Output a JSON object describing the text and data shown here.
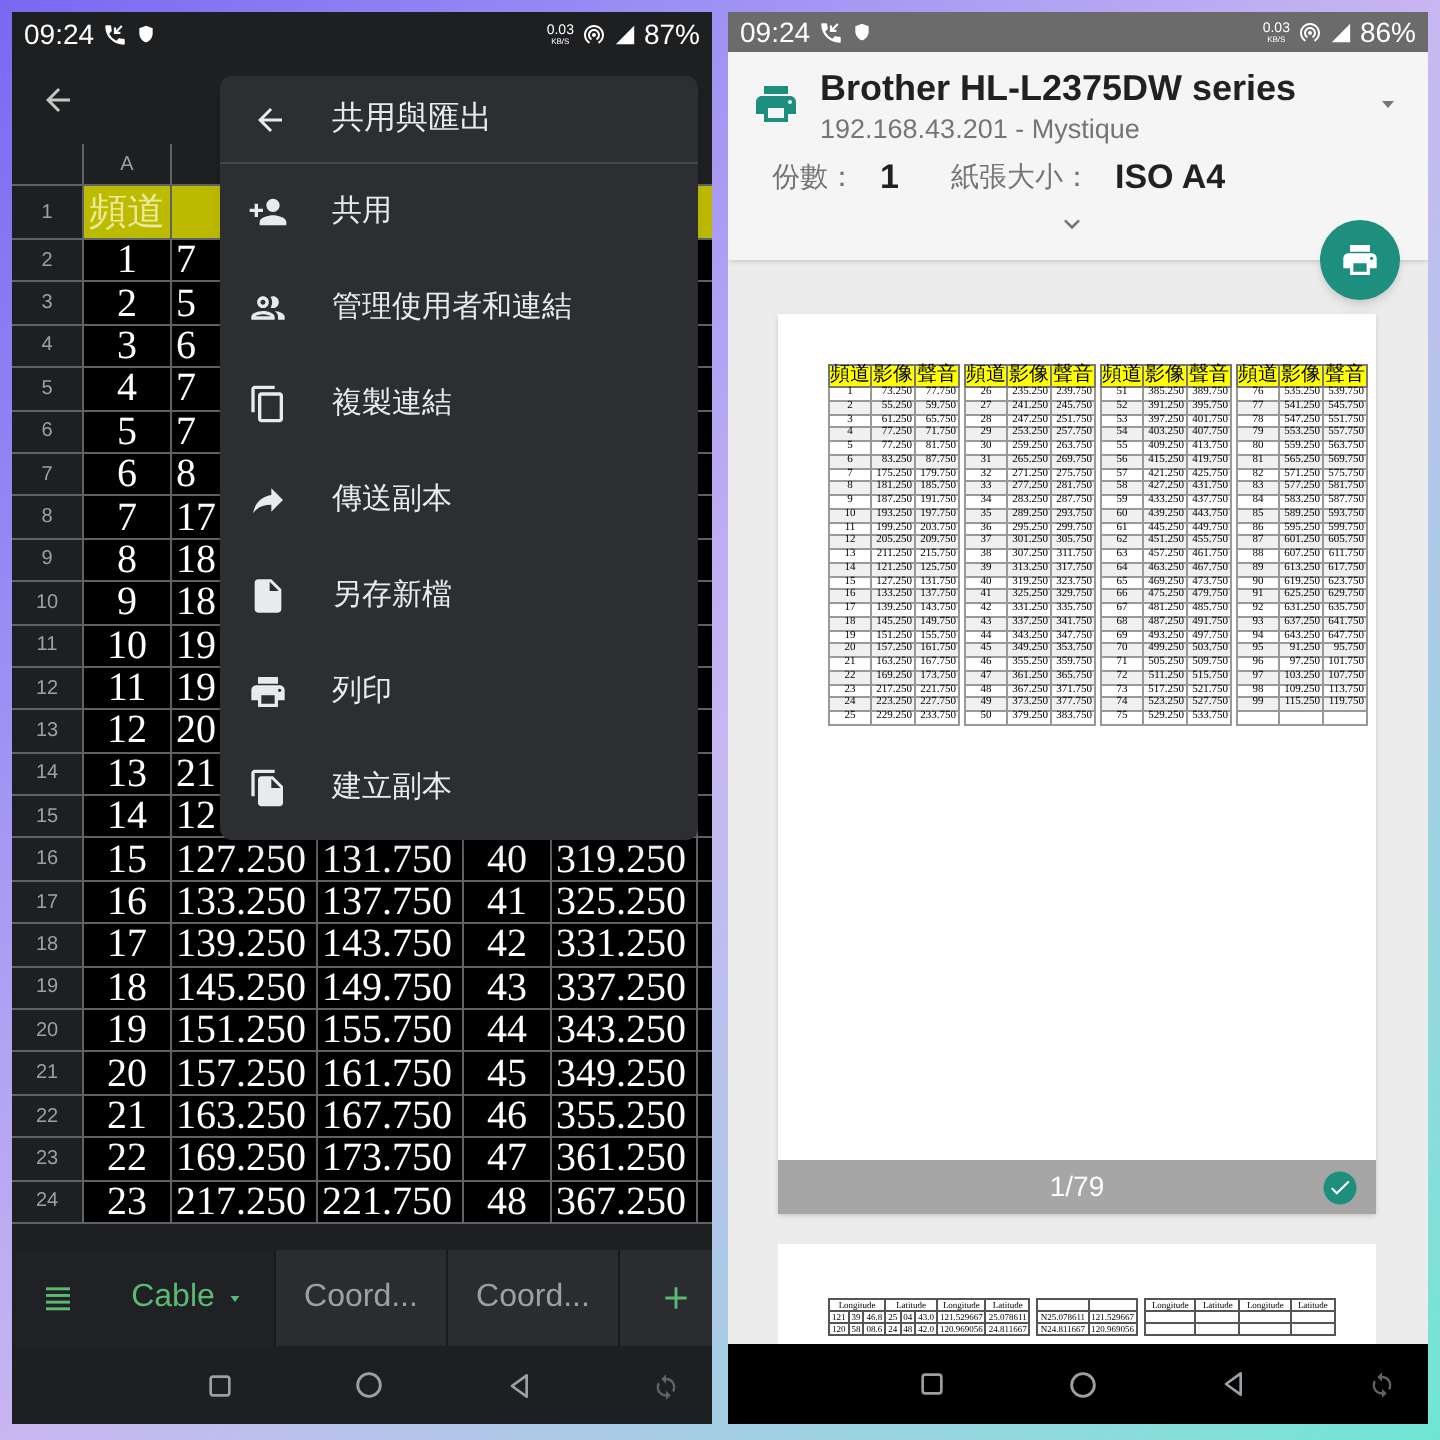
{
  "left": {
    "status_bar": {
      "time": "09:24",
      "speed": "0.03",
      "speed_unit": "KB/S",
      "battery": "87%"
    },
    "sheet": {
      "column_headers": [
        "A"
      ],
      "rows": [
        {
          "number": "1",
          "kind": "header",
          "cells": [
            "頻道"
          ]
        },
        {
          "number": "2",
          "kind": "data",
          "cells": [
            "1",
            "7"
          ]
        },
        {
          "number": "3",
          "kind": "data",
          "cells": [
            "2",
            "5"
          ]
        },
        {
          "number": "4",
          "kind": "data",
          "cells": [
            "3",
            "6"
          ]
        },
        {
          "number": "5",
          "kind": "data",
          "cells": [
            "4",
            "7"
          ]
        },
        {
          "number": "6",
          "kind": "data",
          "cells": [
            "5",
            "7"
          ]
        },
        {
          "number": "7",
          "kind": "data",
          "cells": [
            "6",
            "8"
          ]
        },
        {
          "number": "8",
          "kind": "data",
          "cells": [
            "7",
            "17"
          ]
        },
        {
          "number": "9",
          "kind": "data",
          "cells": [
            "8",
            "18"
          ]
        },
        {
          "number": "10",
          "kind": "data",
          "cells": [
            "9",
            "18"
          ]
        },
        {
          "number": "11",
          "kind": "data",
          "cells": [
            "10",
            "19"
          ]
        },
        {
          "number": "12",
          "kind": "data",
          "cells": [
            "11",
            "19"
          ]
        },
        {
          "number": "13",
          "kind": "data",
          "cells": [
            "12",
            "20"
          ]
        },
        {
          "number": "14",
          "kind": "data",
          "cells": [
            "13",
            "21"
          ]
        },
        {
          "number": "15",
          "kind": "data",
          "cells": [
            "14",
            "12"
          ]
        },
        {
          "number": "16",
          "kind": "data",
          "cells": [
            "15",
            "127.250",
            "131.750",
            "40",
            "319.250"
          ]
        },
        {
          "number": "17",
          "kind": "data",
          "cells": [
            "16",
            "133.250",
            "137.750",
            "41",
            "325.250"
          ]
        },
        {
          "number": "18",
          "kind": "data",
          "cells": [
            "17",
            "139.250",
            "143.750",
            "42",
            "331.250"
          ]
        },
        {
          "number": "19",
          "kind": "data",
          "cells": [
            "18",
            "145.250",
            "149.750",
            "43",
            "337.250"
          ]
        },
        {
          "number": "20",
          "kind": "data",
          "cells": [
            "19",
            "151.250",
            "155.750",
            "44",
            "343.250"
          ]
        },
        {
          "number": "21",
          "kind": "data",
          "cells": [
            "20",
            "157.250",
            "161.750",
            "45",
            "349.250"
          ]
        },
        {
          "number": "22",
          "kind": "data",
          "cells": [
            "21",
            "163.250",
            "167.750",
            "46",
            "355.250"
          ]
        },
        {
          "number": "23",
          "kind": "data",
          "cells": [
            "22",
            "169.250",
            "173.750",
            "47",
            "361.250"
          ]
        },
        {
          "number": "24",
          "kind": "data",
          "cells": [
            "23",
            "217.250",
            "221.750",
            "48",
            "367.250"
          ]
        }
      ]
    },
    "menu": {
      "title": "共用與匯出",
      "items": [
        "共用",
        "管理使用者和連結",
        "複製連結",
        "傳送副本",
        "另存新檔",
        "列印",
        "建立副本"
      ]
    },
    "sheet_tabs": [
      {
        "label": "Cable",
        "selected": true
      },
      {
        "label": "Coord...",
        "selected": false
      },
      {
        "label": "Coord...",
        "selected": false
      }
    ]
  },
  "right": {
    "status_bar": {
      "time": "09:24",
      "speed": "0.03",
      "speed_unit": "KB/S",
      "battery": "86%"
    },
    "printer": {
      "name": "Brother HL-L2375DW series",
      "address": "192.168.43.201 - Mystique"
    },
    "copies_label": "份數：",
    "copies": "1",
    "paper_label": "紙張大小：",
    "paper": "ISO A4",
    "preview": {
      "page_indicator": "1/79",
      "selected": true,
      "groups": [
        {
          "header": [
            "頻道",
            "影像",
            "聲音"
          ],
          "rows": [
            [
              "1",
              "73.250",
              "77.750"
            ],
            [
              "2",
              "55.250",
              "59.750"
            ],
            [
              "3",
              "61.250",
              "65.750"
            ],
            [
              "4",
              "77.250",
              "71.750"
            ],
            [
              "5",
              "77.250",
              "81.750"
            ],
            [
              "6",
              "83.250",
              "87.750"
            ],
            [
              "7",
              "175.250",
              "179.750"
            ],
            [
              "8",
              "181.250",
              "185.750"
            ],
            [
              "9",
              "187.250",
              "191.750"
            ],
            [
              "10",
              "193.250",
              "197.750"
            ],
            [
              "11",
              "199.250",
              "203.750"
            ],
            [
              "12",
              "205.250",
              "209.750"
            ],
            [
              "13",
              "211.250",
              "215.750"
            ],
            [
              "14",
              "121.250",
              "125.750"
            ],
            [
              "15",
              "127.250",
              "131.750"
            ],
            [
              "16",
              "133.250",
              "137.750"
            ],
            [
              "17",
              "139.250",
              "143.750"
            ],
            [
              "18",
              "145.250",
              "149.750"
            ],
            [
              "19",
              "151.250",
              "155.750"
            ],
            [
              "20",
              "157.250",
              "161.750"
            ],
            [
              "21",
              "163.250",
              "167.750"
            ],
            [
              "22",
              "169.250",
              "173.750"
            ],
            [
              "23",
              "217.250",
              "221.750"
            ],
            [
              "24",
              "223.250",
              "227.750"
            ],
            [
              "25",
              "229.250",
              "233.750"
            ]
          ]
        },
        {
          "header": [
            "頻道",
            "影像",
            "聲音"
          ],
          "rows": [
            [
              "26",
              "235.250",
              "239.750"
            ],
            [
              "27",
              "241.250",
              "245.750"
            ],
            [
              "28",
              "247.250",
              "251.750"
            ],
            [
              "29",
              "253.250",
              "257.750"
            ],
            [
              "30",
              "259.250",
              "263.750"
            ],
            [
              "31",
              "265.250",
              "269.750"
            ],
            [
              "32",
              "271.250",
              "275.750"
            ],
            [
              "33",
              "277.250",
              "281.750"
            ],
            [
              "34",
              "283.250",
              "287.750"
            ],
            [
              "35",
              "289.250",
              "293.750"
            ],
            [
              "36",
              "295.250",
              "299.750"
            ],
            [
              "37",
              "301.250",
              "305.750"
            ],
            [
              "38",
              "307.250",
              "311.750"
            ],
            [
              "39",
              "313.250",
              "317.750"
            ],
            [
              "40",
              "319.250",
              "323.750"
            ],
            [
              "41",
              "325.250",
              "329.750"
            ],
            [
              "42",
              "331.250",
              "335.750"
            ],
            [
              "43",
              "337.250",
              "341.750"
            ],
            [
              "44",
              "343.250",
              "347.750"
            ],
            [
              "45",
              "349.250",
              "353.750"
            ],
            [
              "46",
              "355.250",
              "359.750"
            ],
            [
              "47",
              "361.250",
              "365.750"
            ],
            [
              "48",
              "367.250",
              "371.750"
            ],
            [
              "49",
              "373.250",
              "377.750"
            ],
            [
              "50",
              "379.250",
              "383.750"
            ]
          ]
        },
        {
          "header": [
            "頻道",
            "影像",
            "聲音"
          ],
          "rows": [
            [
              "51",
              "385.250",
              "389.750"
            ],
            [
              "52",
              "391.250",
              "395.750"
            ],
            [
              "53",
              "397.250",
              "401.750"
            ],
            [
              "54",
              "403.250",
              "407.750"
            ],
            [
              "55",
              "409.250",
              "413.750"
            ],
            [
              "56",
              "415.250",
              "419.750"
            ],
            [
              "57",
              "421.250",
              "425.750"
            ],
            [
              "58",
              "427.250",
              "431.750"
            ],
            [
              "59",
              "433.250",
              "437.750"
            ],
            [
              "60",
              "439.250",
              "443.750"
            ],
            [
              "61",
              "445.250",
              "449.750"
            ],
            [
              "62",
              "451.250",
              "455.750"
            ],
            [
              "63",
              "457.250",
              "461.750"
            ],
            [
              "64",
              "463.250",
              "467.750"
            ],
            [
              "65",
              "469.250",
              "473.750"
            ],
            [
              "66",
              "475.250",
              "479.750"
            ],
            [
              "67",
              "481.250",
              "485.750"
            ],
            [
              "68",
              "487.250",
              "491.750"
            ],
            [
              "69",
              "493.250",
              "497.750"
            ],
            [
              "70",
              "499.250",
              "503.750"
            ],
            [
              "71",
              "505.250",
              "509.750"
            ],
            [
              "72",
              "511.250",
              "515.750"
            ],
            [
              "73",
              "517.250",
              "521.750"
            ],
            [
              "74",
              "523.250",
              "527.750"
            ],
            [
              "75",
              "529.250",
              "533.750"
            ]
          ]
        },
        {
          "header": [
            "頻道",
            "影像",
            "聲音"
          ],
          "rows": [
            [
              "76",
              "535.250",
              "539.750"
            ],
            [
              "77",
              "541.250",
              "545.750"
            ],
            [
              "78",
              "547.250",
              "551.750"
            ],
            [
              "79",
              "553.250",
              "557.750"
            ],
            [
              "80",
              "559.250",
              "563.750"
            ],
            [
              "81",
              "565.250",
              "569.750"
            ],
            [
              "82",
              "571.250",
              "575.750"
            ],
            [
              "83",
              "577.250",
              "581.750"
            ],
            [
              "84",
              "583.250",
              "587.750"
            ],
            [
              "85",
              "589.250",
              "593.750"
            ],
            [
              "86",
              "595.250",
              "599.750"
            ],
            [
              "87",
              "601.250",
              "605.750"
            ],
            [
              "88",
              "607.250",
              "611.750"
            ],
            [
              "89",
              "613.250",
              "617.750"
            ],
            [
              "90",
              "619.250",
              "623.750"
            ],
            [
              "91",
              "625.250",
              "629.750"
            ],
            [
              "92",
              "631.250",
              "635.750"
            ],
            [
              "93",
              "637.250",
              "641.750"
            ],
            [
              "94",
              "643.250",
              "647.750"
            ],
            [
              "95",
              "91.250",
              "95.750"
            ],
            [
              "96",
              "97.250",
              "101.750"
            ],
            [
              "97",
              "103.250",
              "107.750"
            ],
            [
              "98",
              "109.250",
              "113.750"
            ],
            [
              "99",
              "115.250",
              "119.750"
            ]
          ]
        }
      ]
    },
    "next_page": {
      "left_table": {
        "header": [
          "Longitude",
          "Latitude",
          "Longitude",
          "Latitude"
        ],
        "rows": [
          [
            "121",
            "39",
            "46.8",
            "25",
            "04",
            "43.0",
            "121.529667",
            "25.078611"
          ],
          [
            "120",
            "58",
            "08.6",
            "24",
            "48",
            "42.0",
            "120.969056",
            "24.811667"
          ]
        ]
      },
      "middle_table": {
        "rows": [
          [
            "N25.078611",
            "121.529667"
          ],
          [
            "N24.811667",
            "120.969056"
          ]
        ]
      },
      "right_table": {
        "header": [
          "Longitude",
          "Latitude",
          "Longitude",
          "Latitude"
        ]
      }
    }
  }
}
